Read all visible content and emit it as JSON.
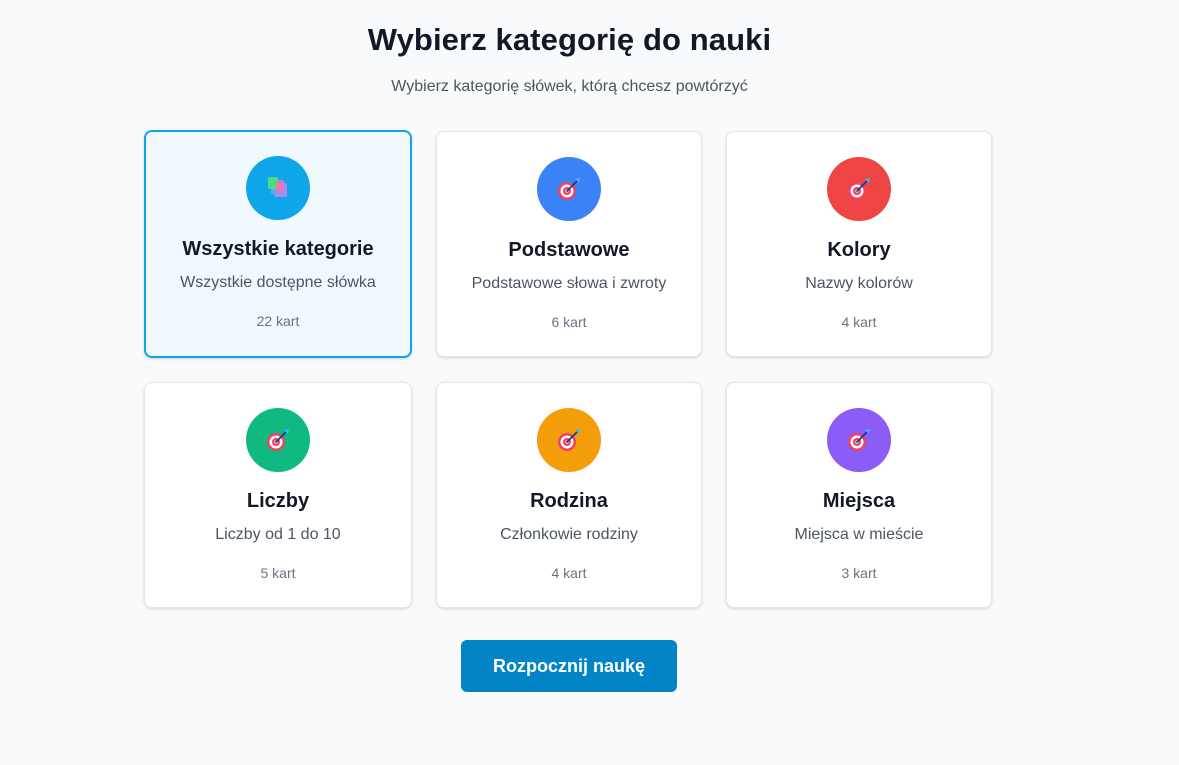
{
  "header": {
    "title": "Wybierz kategorię do nauki",
    "subtitle": "Wybierz kategorię słówek, którą chcesz powtórzyć"
  },
  "categories": [
    {
      "name": "Wszystkie kategorie",
      "description": "Wszystkie dostępne słówka",
      "count": "22 kart",
      "icon": "stacked-cards-icon",
      "color": "#0ea5e9",
      "selected": true
    },
    {
      "name": "Podstawowe",
      "description": "Podstawowe słowa i zwroty",
      "count": "6 kart",
      "icon": "target-icon",
      "color": "#3b82f6",
      "selected": false
    },
    {
      "name": "Kolory",
      "description": "Nazwy kolorów",
      "count": "4 kart",
      "icon": "target-icon",
      "color": "#ef4444",
      "selected": false
    },
    {
      "name": "Liczby",
      "description": "Liczby od 1 do 10",
      "count": "5 kart",
      "icon": "target-icon",
      "color": "#10b981",
      "selected": false
    },
    {
      "name": "Rodzina",
      "description": "Członkowie rodziny",
      "count": "4 kart",
      "icon": "target-icon",
      "color": "#f59e0b",
      "selected": false
    },
    {
      "name": "Miejsca",
      "description": "Miejsca w mieście",
      "count": "3 kart",
      "icon": "target-icon",
      "color": "#8b5cf6",
      "selected": false
    }
  ],
  "actions": {
    "start_label": "Rozpocznij naukę"
  },
  "colors": {
    "accent": "#0284c7",
    "selected_border": "#0ea5e9",
    "selected_bg": "#f0f9ff"
  }
}
